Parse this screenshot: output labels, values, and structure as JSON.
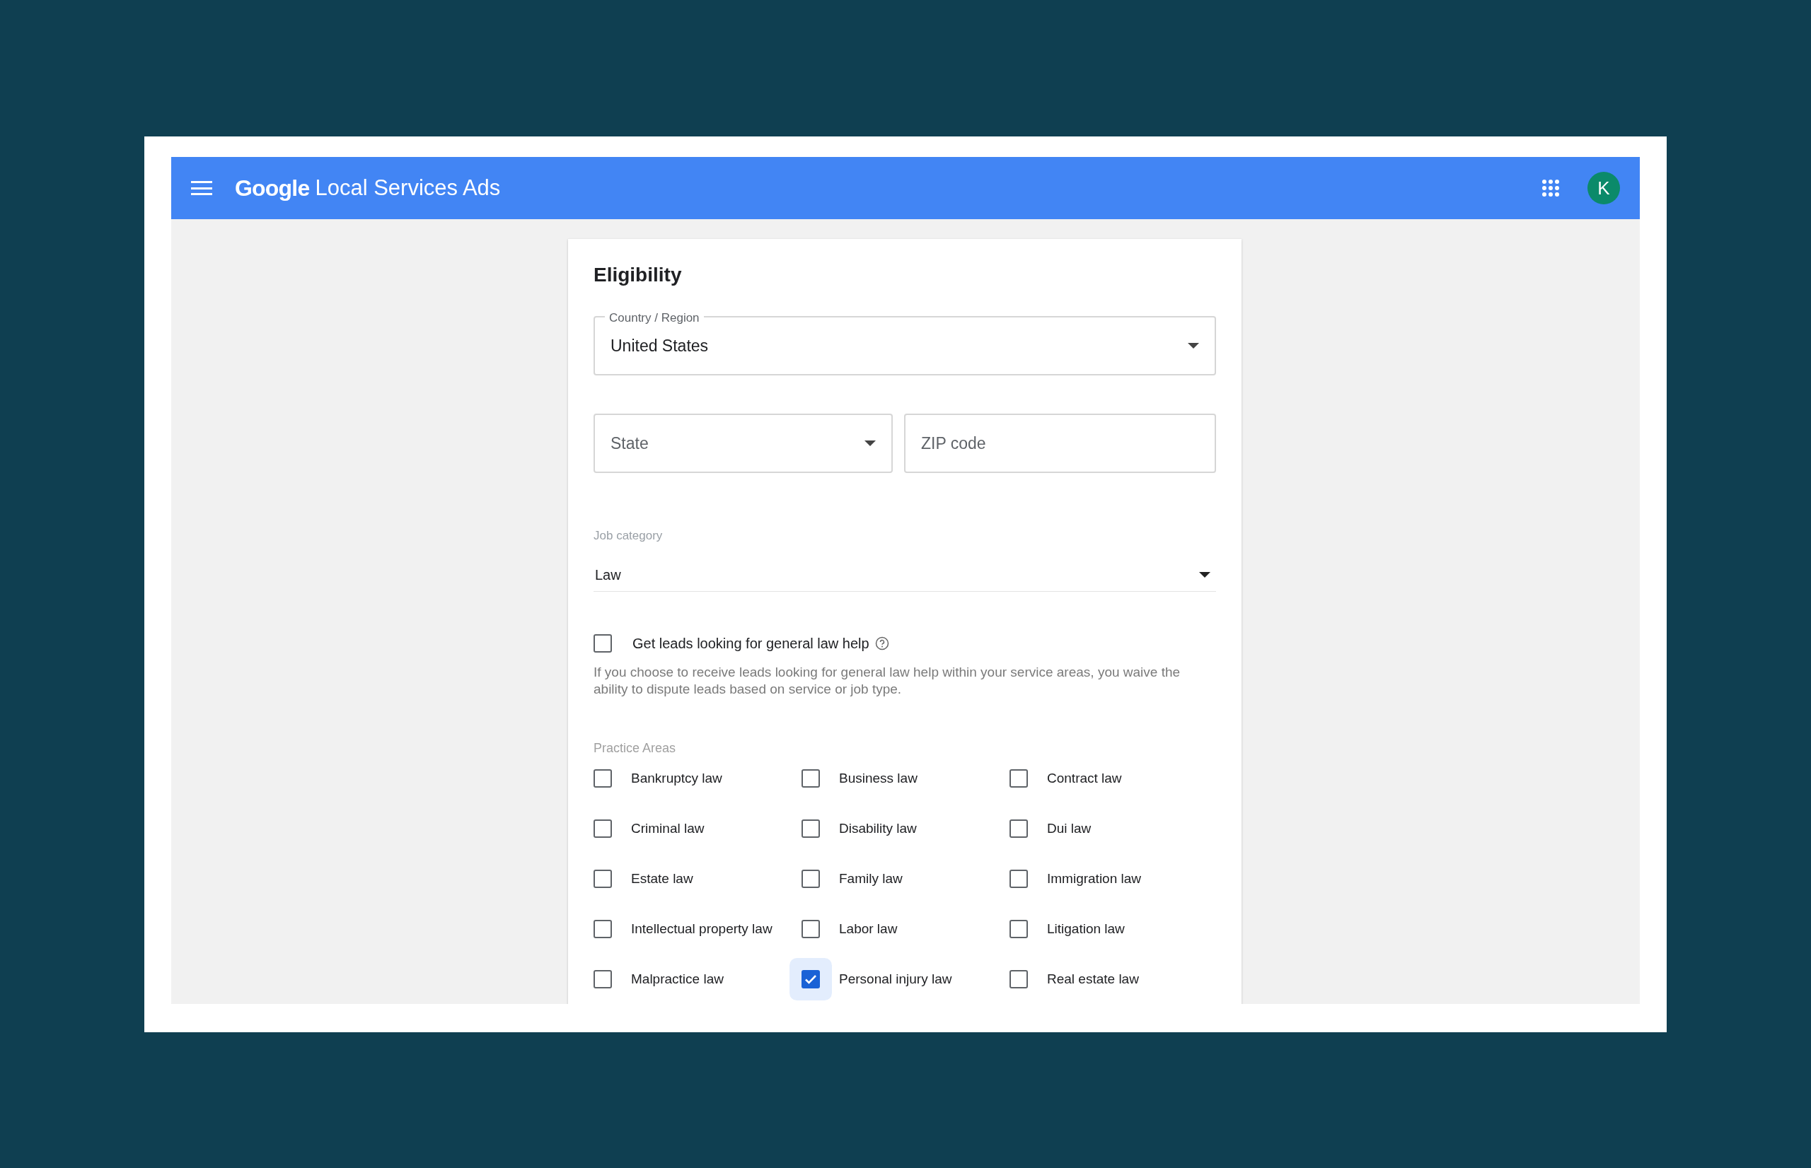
{
  "header": {
    "logo": "Google",
    "product": "Local Services Ads",
    "avatar": "K"
  },
  "form": {
    "title": "Eligibility",
    "country": {
      "label": "Country / Region",
      "value": "United States"
    },
    "state": {
      "placeholder": "State"
    },
    "zip": {
      "placeholder": "ZIP code"
    },
    "job_category": {
      "label": "Job category",
      "value": "Law"
    },
    "general_help": {
      "label": "Get leads looking for general law help",
      "checked": false,
      "note": "If you choose to receive leads looking for general law help within your service areas, you waive the ability to dispute leads based on service or job type."
    },
    "practice_areas": {
      "label": "Practice Areas",
      "items": [
        {
          "label": "Bankruptcy law",
          "checked": false
        },
        {
          "label": "Business law",
          "checked": false
        },
        {
          "label": "Contract law",
          "checked": false
        },
        {
          "label": "Criminal law",
          "checked": false
        },
        {
          "label": "Disability law",
          "checked": false
        },
        {
          "label": "Dui law",
          "checked": false
        },
        {
          "label": "Estate law",
          "checked": false
        },
        {
          "label": "Family law",
          "checked": false
        },
        {
          "label": "Immigration law",
          "checked": false
        },
        {
          "label": "Intellectual property law",
          "checked": false
        },
        {
          "label": "Labor law",
          "checked": false
        },
        {
          "label": "Litigation law",
          "checked": false
        },
        {
          "label": "Malpractice law",
          "checked": false
        },
        {
          "label": "Personal injury law",
          "checked": true
        },
        {
          "label": "Real estate law",
          "checked": false
        }
      ]
    }
  }
}
